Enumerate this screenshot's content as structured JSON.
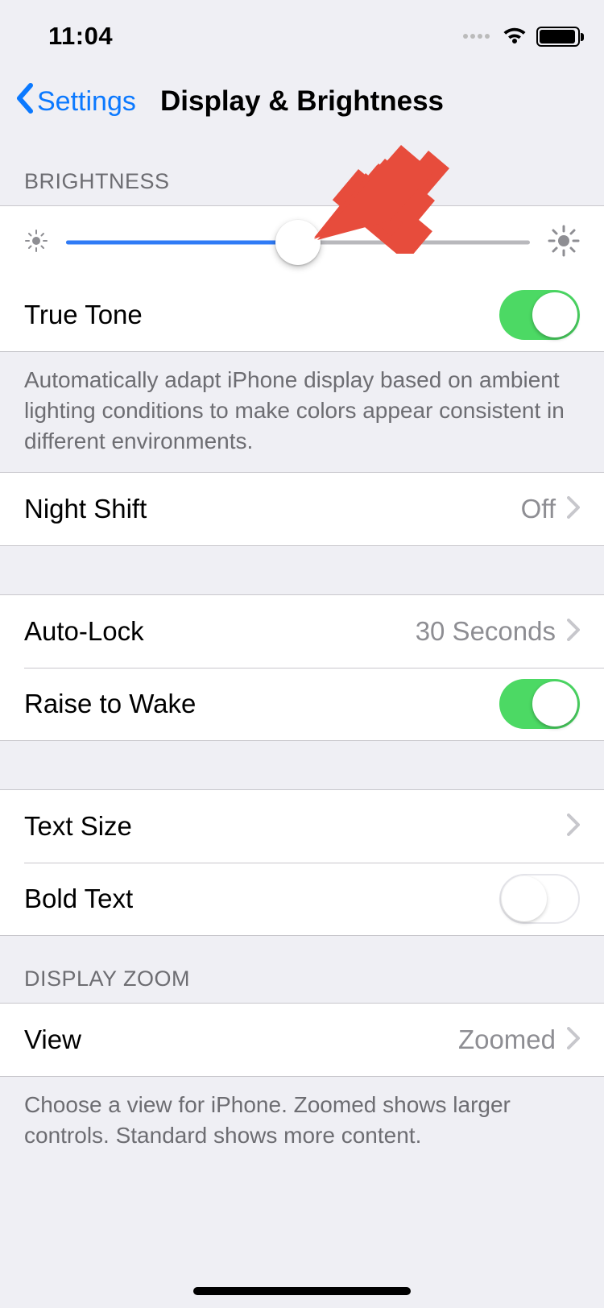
{
  "status": {
    "time": "11:04"
  },
  "nav": {
    "back_label": "Settings",
    "title": "Display & Brightness"
  },
  "brightness": {
    "header": "BRIGHTNESS",
    "slider_percent": 50,
    "true_tone_label": "True Tone",
    "true_tone_on": true,
    "footer": "Automatically adapt iPhone display based on ambient lighting conditions to make colors appear consistent in different environments."
  },
  "night_shift": {
    "label": "Night Shift",
    "value": "Off"
  },
  "auto_lock": {
    "label": "Auto-Lock",
    "value": "30 Seconds"
  },
  "raise_to_wake": {
    "label": "Raise to Wake",
    "on": true
  },
  "text_size": {
    "label": "Text Size"
  },
  "bold_text": {
    "label": "Bold Text",
    "on": false
  },
  "display_zoom": {
    "header": "DISPLAY ZOOM",
    "view_label": "View",
    "view_value": "Zoomed",
    "footer": "Choose a view for iPhone. Zoomed shows larger controls. Standard shows more content."
  },
  "colors": {
    "accent": "#0b79ff",
    "toggle_on": "#4cd964",
    "annotation_arrow": "#e74c3c"
  }
}
